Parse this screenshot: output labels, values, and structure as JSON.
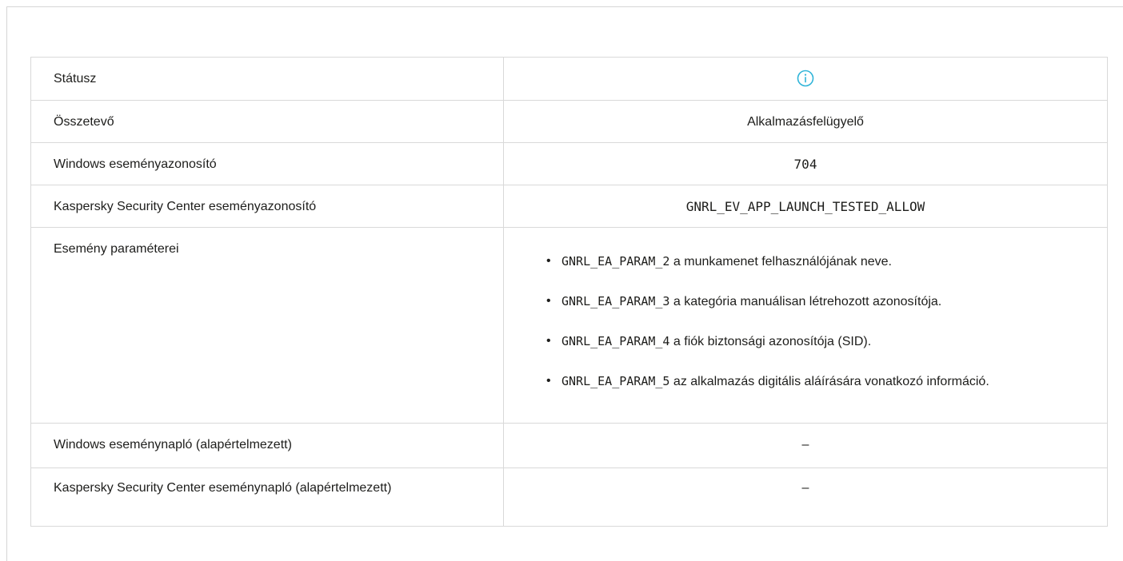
{
  "colors": {
    "info_icon": "#2fb4d8",
    "border": "#d9d9d9",
    "text": "#1d1d1b"
  },
  "rows": {
    "status": {
      "label": "Státusz",
      "icon": "info-circle-icon"
    },
    "component": {
      "label": "Összetevő",
      "value": "Alkalmazásfelügyelő"
    },
    "windows_event_id": {
      "label": "Windows eseményazonosító",
      "value": "704"
    },
    "ksc_event_id": {
      "label": "Kaspersky Security Center eseményazonosító",
      "value": "GNRL_EV_APP_LAUNCH_TESTED_ALLOW"
    },
    "event_params": {
      "label": "Esemény paraméterei",
      "items": [
        {
          "code": "GNRL_EA_PARAM_2",
          "text": "a munkamenet felhasználójának neve."
        },
        {
          "code": "GNRL_EA_PARAM_3",
          "text": "a kategória manuálisan létrehozott azonosítója."
        },
        {
          "code": "GNRL_EA_PARAM_4",
          "text": "a fiók biztonsági azonosítója (SID)."
        },
        {
          "code": "GNRL_EA_PARAM_5",
          "text": "az alkalmazás digitális aláírására vonatkozó információ."
        }
      ]
    },
    "windows_log": {
      "label": "Windows eseménynapló (alapértelmezett)",
      "value": "–"
    },
    "ksc_log": {
      "label": "Kaspersky Security Center eseménynapló (alapértelmezett)",
      "value": "–"
    }
  }
}
